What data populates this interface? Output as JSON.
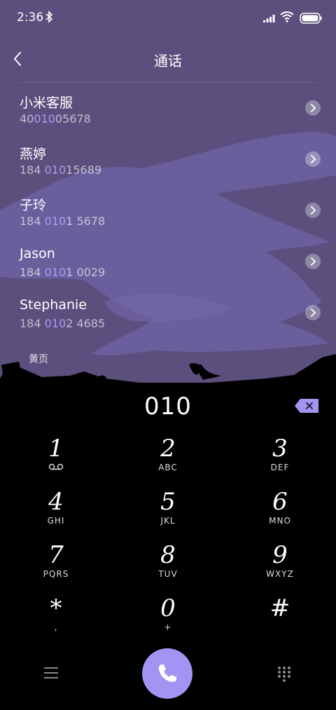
{
  "status_bar": {
    "time": "2:36",
    "icons": [
      "bluetooth-icon",
      "signal-icon",
      "wifi-icon",
      "battery-icon"
    ]
  },
  "header": {
    "title": "通话",
    "back_icon": "chevron-left-icon"
  },
  "contacts": [
    {
      "name": "小米客服",
      "number_pre": "40",
      "number_hl": "010",
      "number_post": "05678"
    },
    {
      "name": "燕婷",
      "number_pre": "184 ",
      "number_hl": "010",
      "number_post": "15689"
    },
    {
      "name": "子玲",
      "number_pre": "184 ",
      "number_hl": "010",
      "number_post": "1 5678"
    },
    {
      "name": "Jason",
      "number_pre": "184 ",
      "number_hl": "010",
      "number_post": "1 0029"
    },
    {
      "name": "Stephanie",
      "number_pre": "184 ",
      "number_hl": "010",
      "number_post": "2 4685"
    }
  ],
  "yellow_pages": "黄页",
  "dialer": {
    "entered": "010",
    "keys": [
      {
        "digit": "1",
        "letters": ""
      },
      {
        "digit": "2",
        "letters": "ABC"
      },
      {
        "digit": "3",
        "letters": "DEF"
      },
      {
        "digit": "4",
        "letters": "GHI"
      },
      {
        "digit": "5",
        "letters": "JKL"
      },
      {
        "digit": "6",
        "letters": "MNO"
      },
      {
        "digit": "7",
        "letters": "PQRS"
      },
      {
        "digit": "8",
        "letters": "TUV"
      },
      {
        "digit": "9",
        "letters": "WXYZ"
      },
      {
        "digit": "*",
        "letters": ","
      },
      {
        "digit": "0",
        "letters": "+"
      },
      {
        "digit": "#",
        "letters": ""
      }
    ]
  },
  "colors": {
    "header_bg": "#5b4f7d",
    "accent": "#a593f4",
    "highlight": "#a99cf4"
  }
}
